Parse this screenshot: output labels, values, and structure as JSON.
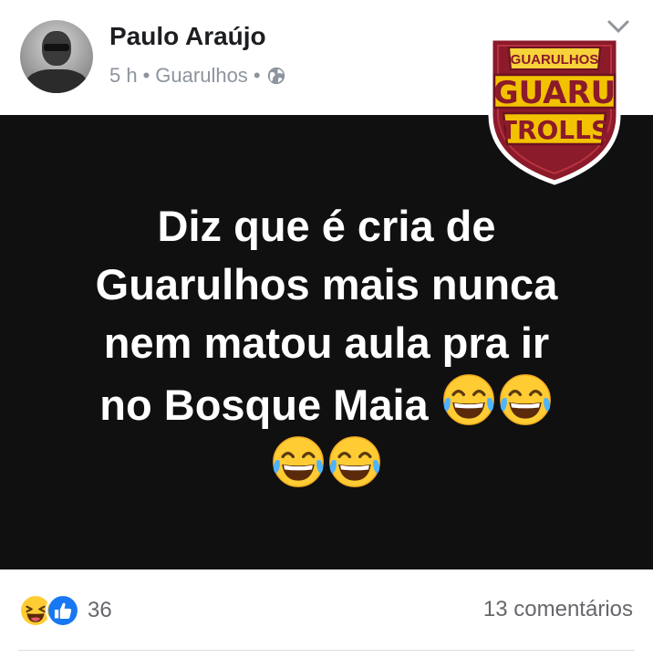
{
  "post": {
    "author": "Paulo Araújo",
    "time": "5 h",
    "separator": "•",
    "location": "Guarulhos",
    "privacy_icon": "globe-icon",
    "text_lines": [
      "Diz que é cria de",
      "Guarulhos mais nunca",
      "nem matou aula pra ir",
      "no Bosque Maia"
    ],
    "trailing_emoji": "face-with-tears-of-joy-icon",
    "logo": {
      "top_text": "GUARULHOS",
      "main_text": "GUARU",
      "bottom_text": "TROLLS"
    }
  },
  "footer": {
    "reaction_icons": [
      "laughing-reaction-icon",
      "like-reaction-icon"
    ],
    "reaction_count": "36",
    "comments": "13 comentários"
  },
  "colors": {
    "post_background": "#101010",
    "logo_red": "#8b1a2a",
    "logo_gold": "#f2c200",
    "facebook_blue": "#1877f2"
  }
}
